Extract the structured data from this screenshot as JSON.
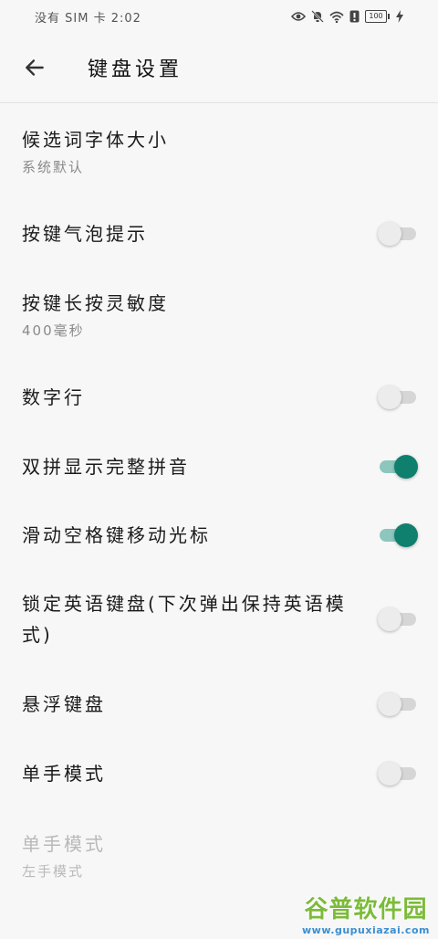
{
  "status_bar": {
    "left_text": "没有 SIM 卡 2:02",
    "battery": "100",
    "icons": [
      "eye-icon",
      "bell-off-icon",
      "wifi-icon",
      "alert-icon",
      "battery-icon",
      "charging-icon"
    ]
  },
  "app_bar": {
    "back_icon": "arrow-left-icon",
    "title": "键盘设置"
  },
  "settings": {
    "candidate_font": {
      "title": "候选词字体大小",
      "summary": "系统默认"
    },
    "key_bubble": {
      "title": "按键气泡提示",
      "on": false
    },
    "long_press": {
      "title": "按键长按灵敏度",
      "summary": "400毫秒"
    },
    "number_row": {
      "title": "数字行",
      "on": false
    },
    "double_pinyin": {
      "title": "双拼显示完整拼音",
      "on": true
    },
    "space_cursor": {
      "title": "滑动空格键移动光标",
      "on": true
    },
    "lock_english": {
      "title": "锁定英语键盘(下次弹出保持英语模式)",
      "on": false
    },
    "floating": {
      "title": "悬浮键盘",
      "on": false
    },
    "one_hand": {
      "title": "单手模式",
      "on": false
    },
    "one_hand_mode": {
      "title": "单手模式",
      "summary": "左手模式",
      "enabled": false
    }
  },
  "colors": {
    "accent": "#0f7f6e",
    "accent_track": "#8dc6bd",
    "off_track": "#d6d6d6"
  },
  "watermark": {
    "name": "谷普软件园",
    "url": "www.gupuxiazai.com"
  }
}
